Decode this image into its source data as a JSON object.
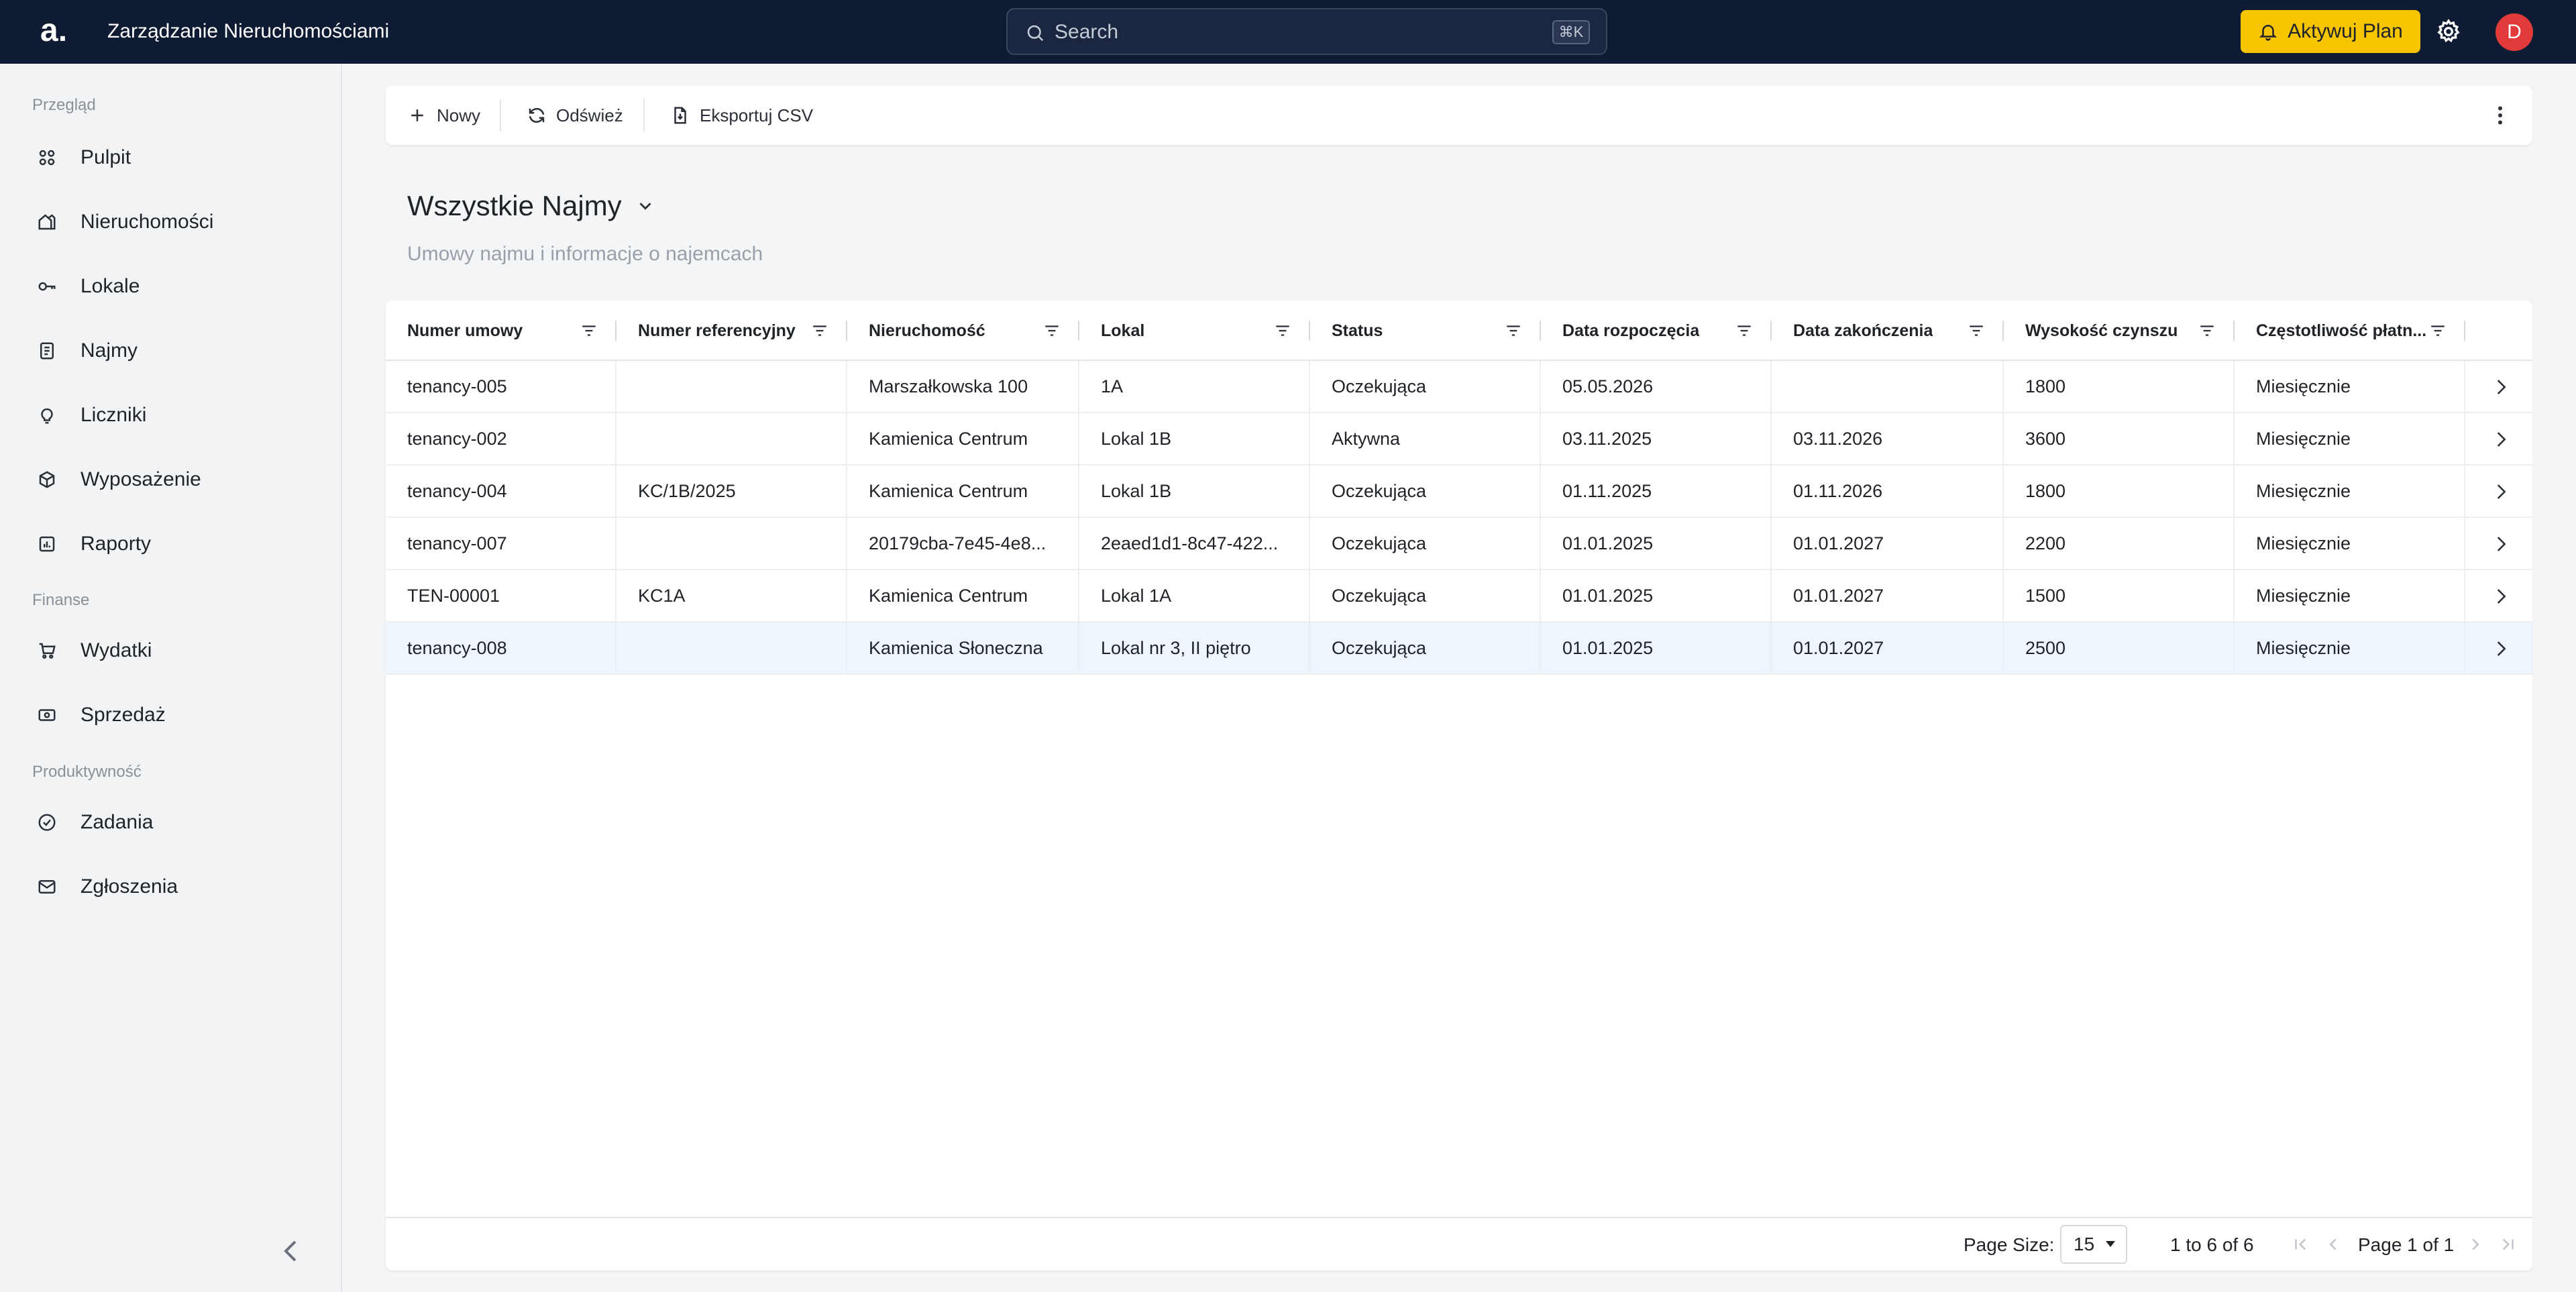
{
  "app": {
    "logo": "a.",
    "title": "Zarządzanie Nieruchomościami"
  },
  "search": {
    "placeholder": "Search",
    "shortcut": "⌘K"
  },
  "header": {
    "activate_label": "Aktywuj Plan",
    "avatar_initial": "D"
  },
  "colors": {
    "topbar": "#0f1b33",
    "accent": "#f7c400",
    "avatar": "#e23a3a",
    "selected_row": "#eef6fd"
  },
  "sidebar": {
    "sections": [
      {
        "label": "Przegląd",
        "items": [
          {
            "label": "Pulpit",
            "icon": "dashboard-icon"
          },
          {
            "label": "Nieruchomości",
            "icon": "building-icon"
          },
          {
            "label": "Lokale",
            "icon": "key-icon"
          },
          {
            "label": "Najmy",
            "icon": "document-icon"
          },
          {
            "label": "Liczniki",
            "icon": "lightbulb-icon"
          },
          {
            "label": "Wyposażenie",
            "icon": "cube-icon"
          },
          {
            "label": "Raporty",
            "icon": "report-icon"
          }
        ]
      },
      {
        "label": "Finanse",
        "items": [
          {
            "label": "Wydatki",
            "icon": "cart-icon"
          },
          {
            "label": "Sprzedaż",
            "icon": "money-icon"
          }
        ]
      },
      {
        "label": "Produktywność",
        "items": [
          {
            "label": "Zadania",
            "icon": "check-circle-icon"
          },
          {
            "label": "Zgłoszenia",
            "icon": "mail-icon"
          }
        ]
      }
    ]
  },
  "toolbar": {
    "new_label": "Nowy",
    "refresh_label": "Odśwież",
    "export_label": "Eksportuj CSV"
  },
  "view": {
    "title": "Wszystkie Najmy",
    "subtitle": "Umowy najmu i informacje o najemcach"
  },
  "table": {
    "columns": [
      "Numer umowy",
      "Numer referencyjny",
      "Nieruchomość",
      "Lokal",
      "Status",
      "Data rozpoczęcia",
      "Data zakończenia",
      "Wysokość czynszu",
      "Częstotliwość płatn..."
    ],
    "rows": [
      [
        "tenancy-005",
        "",
        "Marszałkowska 100",
        "1A",
        "Oczekująca",
        "05.05.2026",
        "",
        "1800",
        "Miesięcznie"
      ],
      [
        "tenancy-002",
        "",
        "Kamienica Centrum",
        "Lokal 1B",
        "Aktywna",
        "03.11.2025",
        "03.11.2026",
        "3600",
        "Miesięcznie"
      ],
      [
        "tenancy-004",
        "KC/1B/2025",
        "Kamienica Centrum",
        "Lokal 1B",
        "Oczekująca",
        "01.11.2025",
        "01.11.2026",
        "1800",
        "Miesięcznie"
      ],
      [
        "tenancy-007",
        "",
        "20179cba-7e45-4e8...",
        "2eaed1d1-8c47-422...",
        "Oczekująca",
        "01.01.2025",
        "01.01.2027",
        "2200",
        "Miesięcznie"
      ],
      [
        "TEN-00001",
        "KC1A",
        "Kamienica Centrum",
        "Lokal 1A",
        "Oczekująca",
        "01.01.2025",
        "01.01.2027",
        "1500",
        "Miesięcznie"
      ],
      [
        "tenancy-008",
        "",
        "Kamienica Słoneczna",
        "Lokal nr 3, II piętro",
        "Oczekująca",
        "01.01.2025",
        "01.01.2027",
        "2500",
        "Miesięcznie"
      ]
    ],
    "selected_row": 5
  },
  "footer": {
    "page_size_label": "Page Size:",
    "page_size": "15",
    "range": "1 to 6 of 6",
    "page_label": "Page 1 of 1"
  }
}
